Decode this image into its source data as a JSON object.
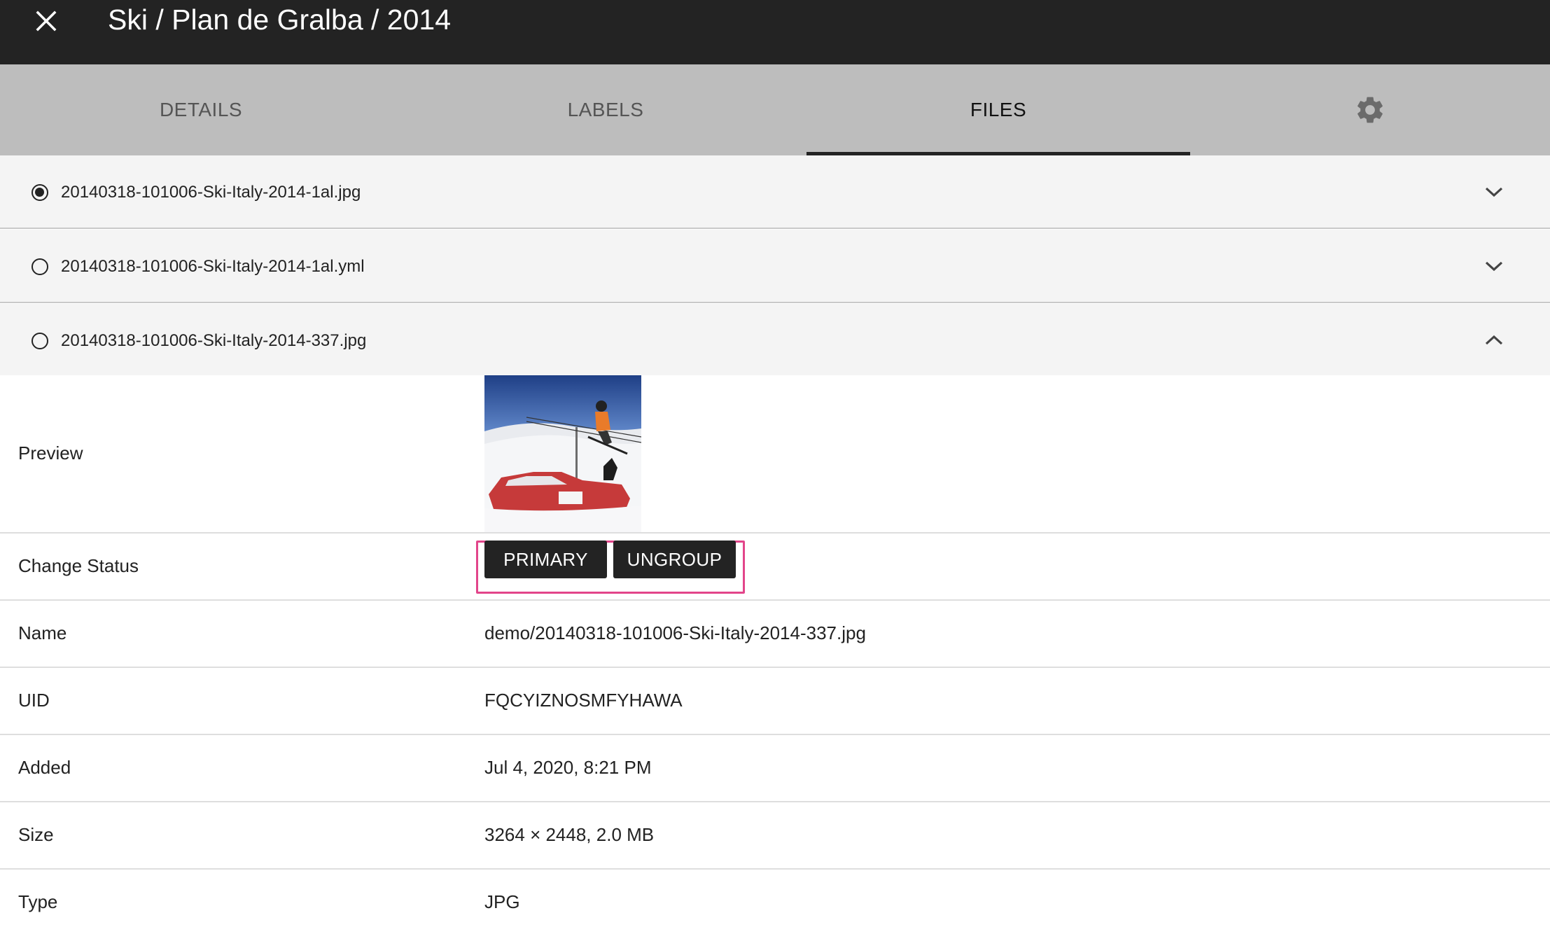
{
  "header": {
    "title": "Ski / Plan de Gralba / 2014",
    "close_icon": "close-icon"
  },
  "tabs": [
    {
      "label": "DETAILS",
      "active": false
    },
    {
      "label": "LABELS",
      "active": false
    },
    {
      "label": "FILES",
      "active": true
    },
    {
      "label": "",
      "icon": "gear-icon",
      "active": false
    }
  ],
  "files": [
    {
      "name": "20140318-101006-Ski-Italy-2014-1al.jpg",
      "selected": true,
      "expanded": false
    },
    {
      "name": "20140318-101006-Ski-Italy-2014-1al.yml",
      "selected": false,
      "expanded": false
    },
    {
      "name": "20140318-101006-Ski-Italy-2014-337.jpg",
      "selected": false,
      "expanded": true
    }
  ],
  "details": {
    "preview_label": "Preview",
    "status_label": "Change Status",
    "buttons": {
      "primary": "PRIMARY",
      "ungroup": "UNGROUP"
    },
    "rows": [
      {
        "label": "Name",
        "value": "demo/20140318-101006-Ski-Italy-2014-337.jpg"
      },
      {
        "label": "UID",
        "value": "FQCYIZNOSMFYHAWA"
      },
      {
        "label": "Added",
        "value": "Jul 4, 2020, 8:21 PM"
      },
      {
        "label": "Size",
        "value": "3264 × 2448, 2.0 MB"
      },
      {
        "label": "Type",
        "value": "JPG"
      }
    ]
  },
  "colors": {
    "topbar": "#232323",
    "tabs_bg": "#bdbdbd",
    "highlight": "#e2458a",
    "button_bg": "#232323"
  }
}
